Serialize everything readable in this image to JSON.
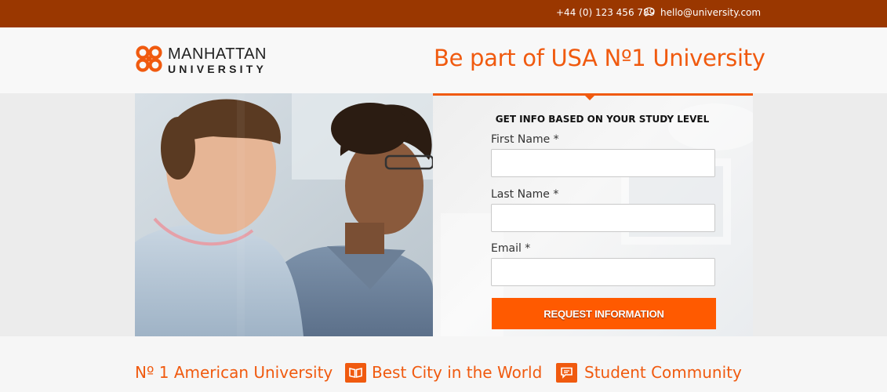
{
  "topbar": {
    "phone": "+44 (0) 123 456 789",
    "email": "hello@university.com",
    "chat_icon": "chat-bubble-icon"
  },
  "header": {
    "logo_line1": "MANHATTAN",
    "logo_line2": "UNIVERSITY",
    "tagline": "Be part of USA Nº1 University"
  },
  "form": {
    "title": "GET INFO BASED ON YOUR STUDY LEVEL",
    "first_name_label": "First Name *",
    "first_name_value": "",
    "last_name_label": "Last Name *",
    "last_name_value": "",
    "email_label": "Email *",
    "email_value": "",
    "submit_label": "REQUEST INFORMATION"
  },
  "features": [
    {
      "label": "Nº 1 American University",
      "icon": ""
    },
    {
      "label": "Best City in the World",
      "icon": "book-icon"
    },
    {
      "label": "Student Community",
      "icon": "chat-icon"
    }
  ],
  "colors": {
    "topbar": "#9a3700",
    "accent": "#f05a0f",
    "button": "#ff5a00"
  }
}
